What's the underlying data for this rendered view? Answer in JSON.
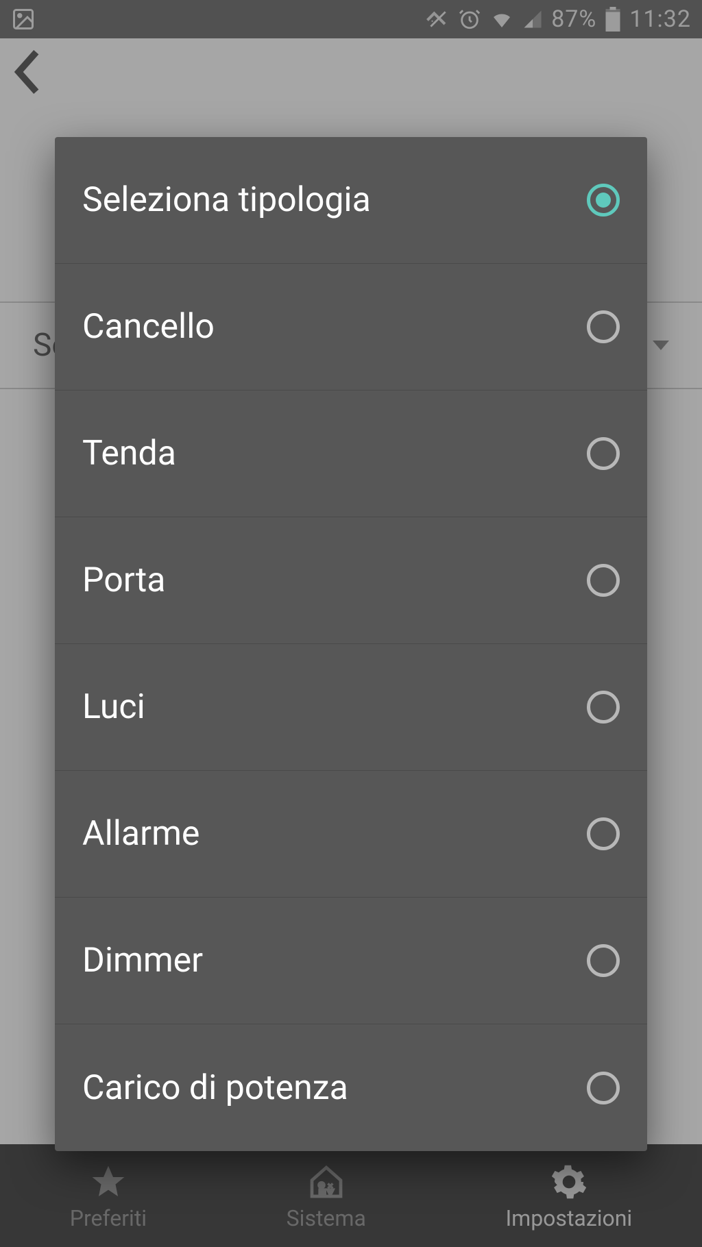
{
  "status_bar": {
    "battery_percent": "87%",
    "time": "11:32"
  },
  "toolbar": {
    "back": "‹"
  },
  "background": {
    "dropdown_label_partial": "Se"
  },
  "bottom_nav": {
    "items": [
      {
        "label": "Preferiti"
      },
      {
        "label": "Sistema"
      },
      {
        "label": "Impostazioni"
      }
    ]
  },
  "dialog": {
    "options": [
      {
        "label": "Seleziona tipologia",
        "selected": true
      },
      {
        "label": "Cancello",
        "selected": false
      },
      {
        "label": "Tenda",
        "selected": false
      },
      {
        "label": "Porta",
        "selected": false
      },
      {
        "label": "Luci",
        "selected": false
      },
      {
        "label": "Allarme",
        "selected": false
      },
      {
        "label": "Dimmer",
        "selected": false
      },
      {
        "label": "Carico di potenza",
        "selected": false
      }
    ]
  }
}
